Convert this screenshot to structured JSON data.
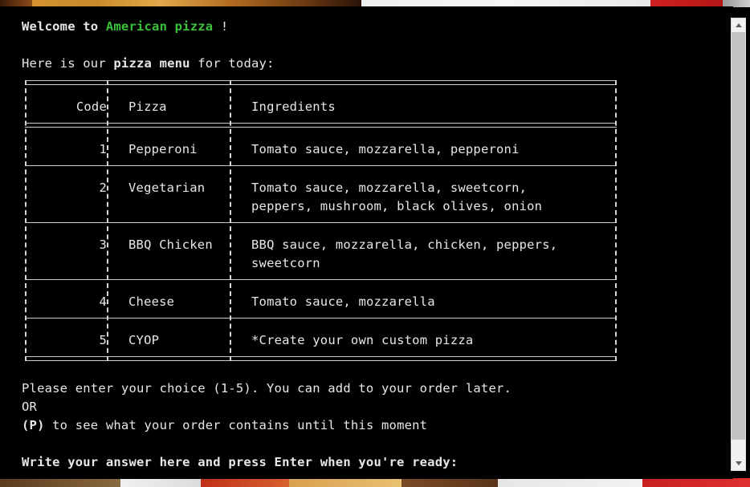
{
  "window": {
    "background_color": "#000000",
    "text_color": "#e9e7e4",
    "accent_color": "#3ac13a"
  },
  "greeting": {
    "prefix": "Welcome to ",
    "brand": "American pizza",
    "suffix": " !"
  },
  "intro": {
    "before": "Here is our ",
    "emphasis": "pizza menu",
    "after": " for today:"
  },
  "menu_table": {
    "headers": {
      "code": "Code",
      "pizza": "Pizza",
      "ingredients": "Ingredients"
    },
    "rows": [
      {
        "code": "1",
        "pizza": "Pepperoni",
        "ingredients": "Tomato sauce, mozzarella, pepperoni"
      },
      {
        "code": "2",
        "pizza": "Vegetarian",
        "ingredients": "Tomato sauce, mozzarella, sweetcorn,\npeppers, mushroom, black olives, onion"
      },
      {
        "code": "3",
        "pizza": "BBQ Chicken",
        "ingredients": "BBQ sauce, mozzarella, chicken, peppers,\nsweetcorn"
      },
      {
        "code": "4",
        "pizza": "Cheese",
        "ingredients": "Tomato sauce, mozzarella"
      },
      {
        "code": "5",
        "pizza": "CYOP",
        "ingredients": "*Create your own custom pizza"
      }
    ]
  },
  "prompt": {
    "line1": "Please enter your choice (1-5). You can add to your order later.",
    "line2": "OR",
    "line3_bold": "(P)",
    "line3_rest": " to see what your order contains until this moment",
    "cta": "Write your answer here and press Enter when you're ready:"
  },
  "scrollbar": {
    "up_arrow": "scroll-up-arrow",
    "down_arrow": "scroll-down-arrow",
    "thumb": "scroll-thumb"
  },
  "decor": {
    "top_strip": "pizza-photo-strip",
    "bottom_strip": "pizza-photo-strip"
  }
}
